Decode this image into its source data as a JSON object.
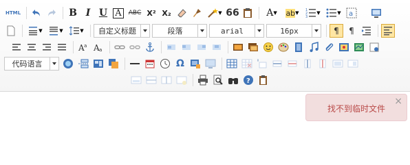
{
  "toolbar": {
    "html_label": "HTML",
    "bold_label": "B",
    "italic_label": "I",
    "underline_label": "U",
    "fontborder_label": "A",
    "strike_label": "ABC",
    "superscript_label": "X²",
    "subscript_label": "X₂",
    "blockquote_label": "66",
    "forecolor_label": "A",
    "backcolor_label": "ab",
    "customstyle_value": "自定义标题",
    "paragraph_value": "段落",
    "fontfamily_value": "arial",
    "fontsize_value": "16px",
    "codelang_value": "代码语言"
  },
  "notification": {
    "message": "找不到临时文件",
    "close_symbol": "×"
  },
  "colors": {
    "accent_blue": "#3f74b8",
    "toast_bg": "#f2dede",
    "toast_text": "#b94a48"
  }
}
